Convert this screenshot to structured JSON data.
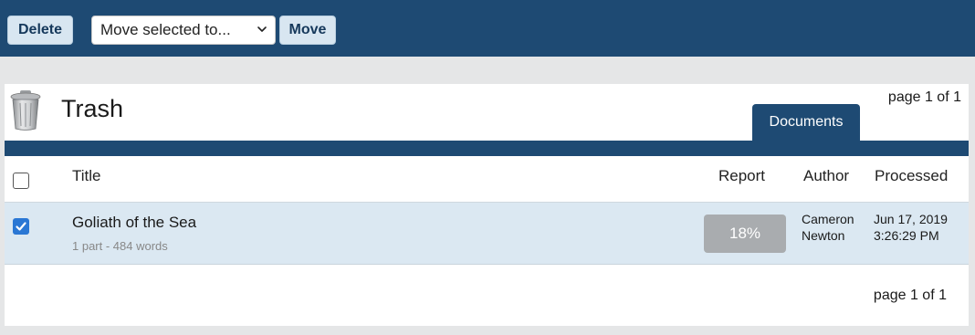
{
  "toolbar": {
    "delete_label": "Delete",
    "move_select_value": "Move selected to...",
    "move_label": "Move"
  },
  "header": {
    "title": "Trash",
    "page_indicator": "page 1 of 1",
    "tab_label": "Documents"
  },
  "table": {
    "columns": {
      "title": "Title",
      "report": "Report",
      "author": "Author",
      "processed": "Processed"
    },
    "rows": [
      {
        "title": "Goliath of the Sea",
        "meta": "1 part - 484 words",
        "report": "18%",
        "author_first": "Cameron",
        "author_last": "Newton",
        "processed_date": "Jun 17, 2019",
        "processed_time": "3:26:29 PM",
        "selected": true
      }
    ]
  },
  "footer": {
    "page_indicator": "page 1 of 1"
  },
  "icons": {
    "trash": "trash-can-icon",
    "chevron": "chevron-down-icon",
    "check": "checkmark-icon"
  },
  "colors": {
    "nav_bg": "#1e4a73",
    "button_bg": "#d8e6f1",
    "row_selected_bg": "#dbe8f2",
    "checkbox_checked": "#2a77d4",
    "report_pill": "#a9acaf"
  }
}
